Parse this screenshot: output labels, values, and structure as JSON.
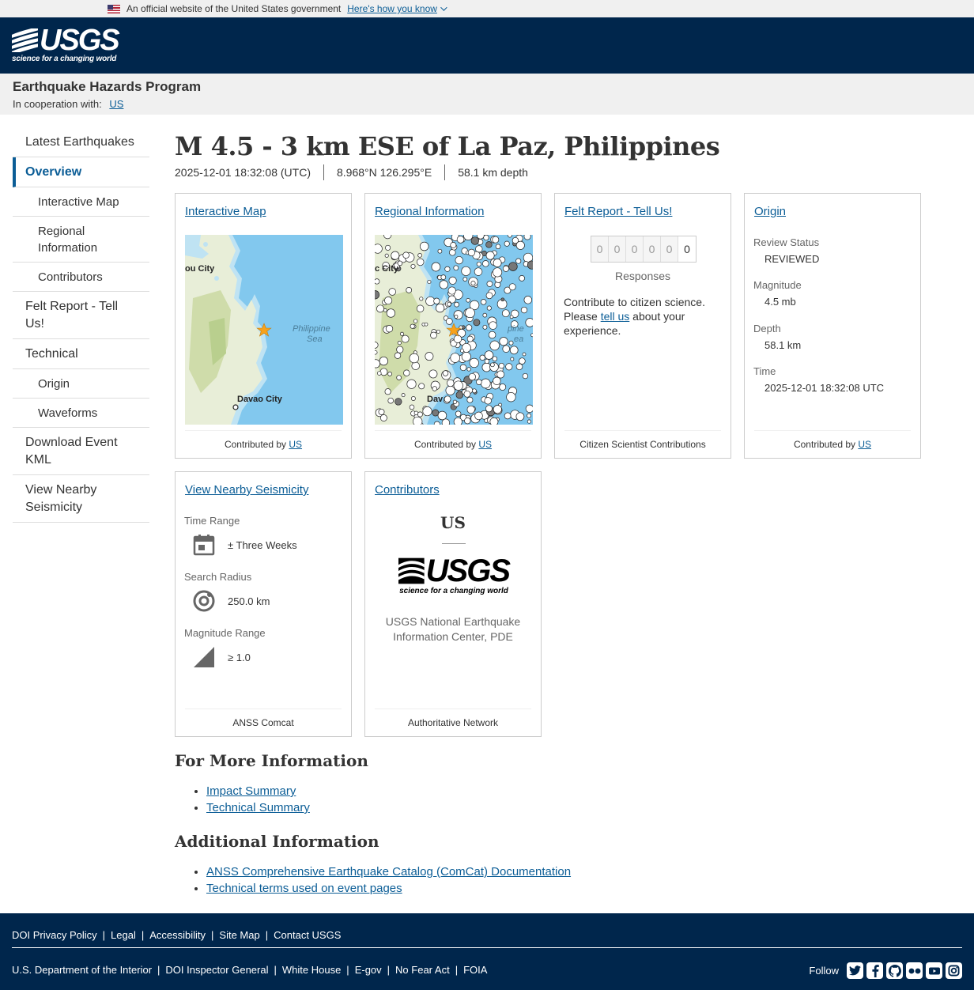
{
  "gov_banner": {
    "text": "An official website of the United States government",
    "how_link": "Here's how you know"
  },
  "header": {
    "logo_word": "USGS",
    "logo_tagline": "science for a changing world"
  },
  "program": {
    "title": "Earthquake Hazards Program",
    "coop_label": "In cooperation with:",
    "coop_link": "US"
  },
  "sidebar": {
    "items": [
      {
        "label": "Latest Earthquakes"
      },
      {
        "label": "Overview"
      },
      {
        "label": "Interactive Map"
      },
      {
        "label": "Regional Information"
      },
      {
        "label": "Contributors"
      },
      {
        "label": "Felt Report - Tell Us!"
      },
      {
        "label": "Technical"
      },
      {
        "label": "Origin"
      },
      {
        "label": "Waveforms"
      },
      {
        "label": "Download Event KML"
      },
      {
        "label": "View Nearby Seismicity"
      }
    ]
  },
  "event": {
    "title": "M 4.5 - 3 km ESE of La Paz, Philippines",
    "time": "2025-12-01 18:32:08 (UTC)",
    "location": "8.968°N 126.295°E",
    "depth": "58.1 km depth"
  },
  "cards": {
    "interactive_map": {
      "title": "Interactive Map",
      "foot_text": "Contributed by",
      "foot_link": "US",
      "labels": {
        "city_top": "ou City",
        "sea_1": "Philippine",
        "sea_2": "Sea",
        "city_bottom": "Davao City"
      }
    },
    "regional": {
      "title": "Regional Information",
      "foot_text": "Contributed by",
      "foot_link": "US",
      "labels": {
        "city_top": "c City",
        "sea_1": "pine",
        "sea_2": "ea",
        "city_bottom": "Dav"
      }
    },
    "felt": {
      "title": "Felt Report - Tell Us!",
      "digits": [
        "0",
        "0",
        "0",
        "0",
        "0",
        "0"
      ],
      "responses": "Responses",
      "text_before": "Contribute to citizen science. Please",
      "link": "tell us",
      "text_after": "about your experience.",
      "foot": "Citizen Scientist Contributions"
    },
    "origin": {
      "title": "Origin",
      "review_label": "Review Status",
      "review_value": "REVIEWED",
      "mag_label": "Magnitude",
      "mag_value": "4.5 mb",
      "depth_label": "Depth",
      "depth_value": "58.1 km",
      "time_label": "Time",
      "time_value": "2025-12-01 18:32:08 UTC",
      "foot_text": "Contributed by",
      "foot_link": "US"
    },
    "seismicity": {
      "title": "View Nearby Seismicity",
      "time_label": "Time Range",
      "time_value": "± Three Weeks",
      "radius_label": "Search Radius",
      "radius_value": "250.0 km",
      "mag_label": "Magnitude Range",
      "mag_value": "≥ 1.0",
      "foot": "ANSS Comcat"
    },
    "contributors": {
      "title": "Contributors",
      "code": "US",
      "logo_word": "USGS",
      "logo_tagline": "science for a changing world",
      "name": "USGS National Earthquake Information Center, PDE",
      "foot": "Authoritative Network"
    }
  },
  "more_info": {
    "title": "For More Information",
    "links": [
      "Impact Summary",
      "Technical Summary"
    ]
  },
  "additional_info": {
    "title": "Additional Information",
    "links": [
      "ANSS Comprehensive Earthquake Catalog (ComCat) Documentation",
      "Technical terms used on event pages"
    ]
  },
  "footer": {
    "row1": [
      "DOI Privacy Policy",
      "Legal",
      "Accessibility",
      "Site Map",
      "Contact USGS"
    ],
    "row2": [
      "U.S. Department of the Interior",
      "DOI Inspector General",
      "White House",
      "E-gov",
      "No Fear Act",
      "FOIA"
    ],
    "follow": "Follow"
  },
  "colors": {
    "navy": "#00264c",
    "link": "#0b5d96",
    "star": "#f7a21b"
  }
}
